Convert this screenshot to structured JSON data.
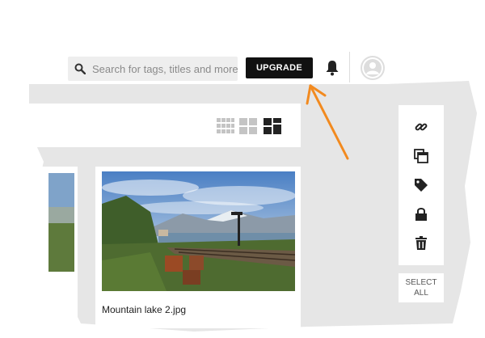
{
  "header": {
    "search_placeholder": "Search for tags, titles and more",
    "upgrade_label": "UPGRADE"
  },
  "icons": {
    "search": "search-icon",
    "bell": "bell-icon",
    "avatar": "user-avatar-icon",
    "views": [
      "small-grid-icon",
      "medium-grid-icon",
      "large-grid-icon"
    ],
    "actions": [
      "link-icon",
      "copy-icon",
      "tag-icon",
      "lock-icon",
      "trash-icon"
    ]
  },
  "gallery": {
    "items": [
      {
        "caption": "Mountain lake 2.jpg"
      }
    ]
  },
  "sidebar": {
    "select_all_line1": "SELECT",
    "select_all_line2": "ALL"
  },
  "colors": {
    "accent_arrow": "#f28a1f",
    "button_bg": "#111111",
    "canvas": "#e6e6e6"
  }
}
